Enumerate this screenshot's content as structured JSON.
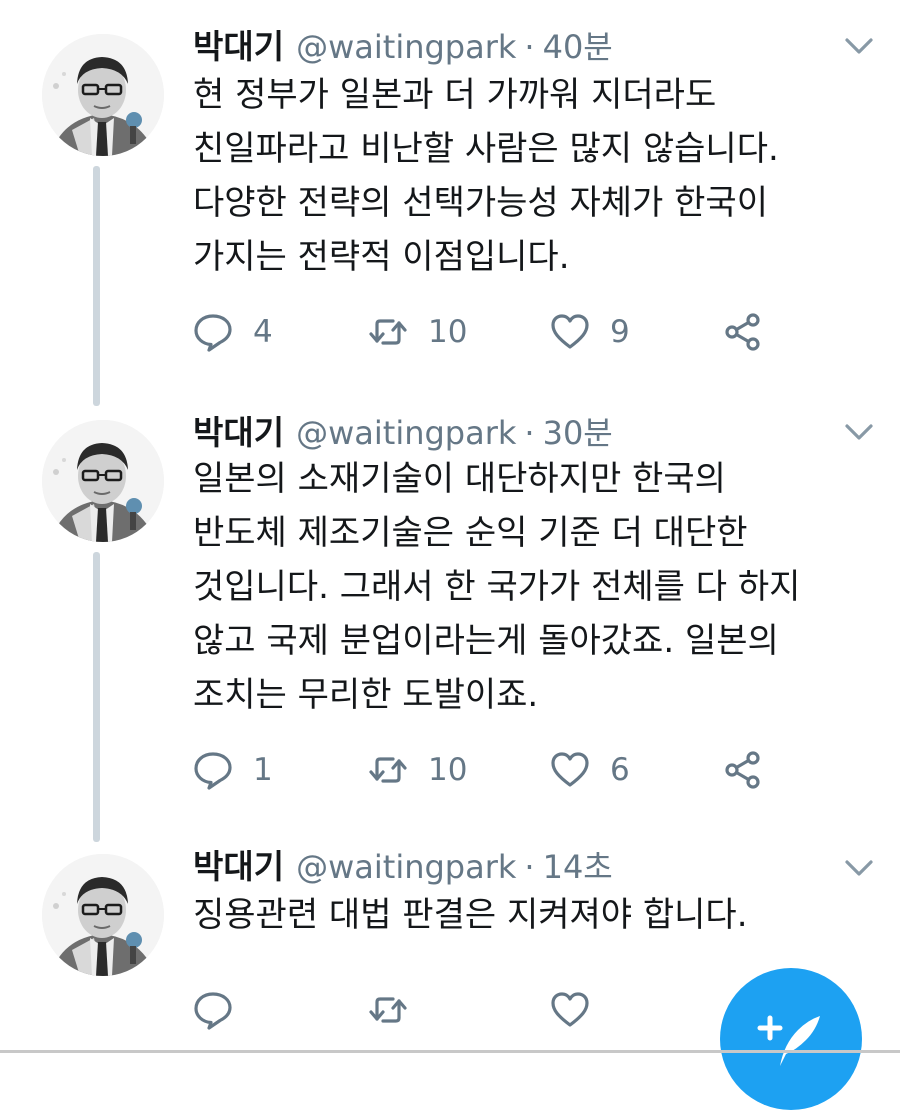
{
  "colors": {
    "accent": "#1da1f2",
    "text": "#14171a",
    "muted": "#657786",
    "thread_line": "#cdd6dd"
  },
  "tweets": [
    {
      "name": "박대기",
      "handle": "@waitingpark",
      "separator": "·",
      "time": "40분",
      "lines": [
        "현 정부가 일본과 더 가까워 지더라도",
        "친일파라고 비난할 사람은 많지 않습니다.",
        "다양한 전략의 선택가능성 자체가 한국이",
        "가지는 전략적 이점입니다."
      ],
      "replies": "4",
      "retweets": "10",
      "likes": "9"
    },
    {
      "name": "박대기",
      "handle": "@waitingpark",
      "separator": "·",
      "time": "30분",
      "lines": [
        "일본의 소재기술이 대단하지만 한국의",
        "반도체 제조기술은 순익 기준 더 대단한",
        "것입니다. 그래서 한 국가가 전체를 다 하지",
        "않고 국제 분업이라는게 돌아갔죠. 일본의",
        "조치는 무리한 도발이죠."
      ],
      "replies": "1",
      "retweets": "10",
      "likes": "6"
    },
    {
      "name": "박대기",
      "handle": "@waitingpark",
      "separator": "·",
      "time": "14초",
      "lines": [
        "징용관련 대법 판결은 지켜져야 합니다."
      ]
    }
  ],
  "icons": {
    "reply": "reply-icon",
    "retweet": "retweet-icon",
    "like": "heart-icon",
    "share": "share-icon",
    "caret": "chevron-down-icon",
    "compose": "compose-tweet-icon"
  }
}
